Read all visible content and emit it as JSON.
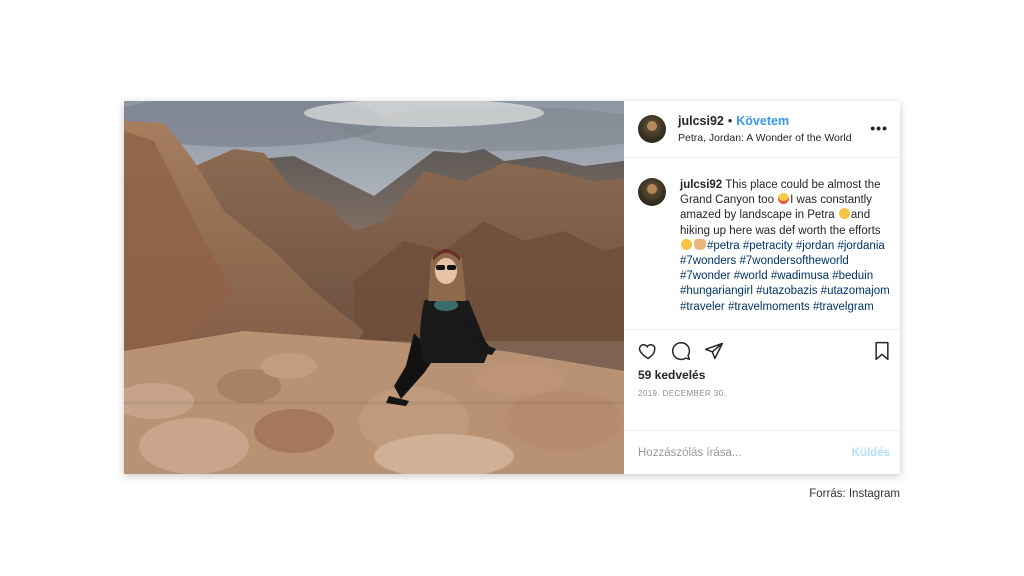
{
  "post": {
    "header": {
      "username": "julcsi92",
      "separator": "•",
      "follow_label": "Követem",
      "location": "Petra, Jordan: A Wonder of the World",
      "more_label": "•••"
    },
    "caption": {
      "username": "julcsi92",
      "text_1": " This place could be almost the Grand Canyon too ",
      "text_2": "I was constantly amazed by landscape in Petra ",
      "text_3": "and hiking up here was def worth the efforts ",
      "hashtags": [
        "#petra",
        "#petracity",
        "#jordan",
        "#jordania",
        "#7wonders",
        "#7wondersoftheworld",
        "#7wonder",
        "#world",
        "#wadimusa",
        "#beduin",
        "#hungariangirl",
        "#utazobazis",
        "#utazomajom",
        "#traveler",
        "#travelmoments",
        "#travelgram"
      ]
    },
    "actions": {
      "like_icon": "heart-icon",
      "comment_icon": "comment-icon",
      "share_icon": "paper-plane-icon",
      "save_icon": "bookmark-icon"
    },
    "likes": "59 kedvelés",
    "date": "2019. DECEMBER 30.",
    "comment": {
      "placeholder": "Hozzászólás írása...",
      "send_label": "Küldés"
    }
  },
  "source": "Forrás: Instagram",
  "colors": {
    "link": "#3897f0",
    "hashtag": "#003569",
    "send_disabled": "#b2dffc",
    "meta": "#8e8e8e"
  }
}
